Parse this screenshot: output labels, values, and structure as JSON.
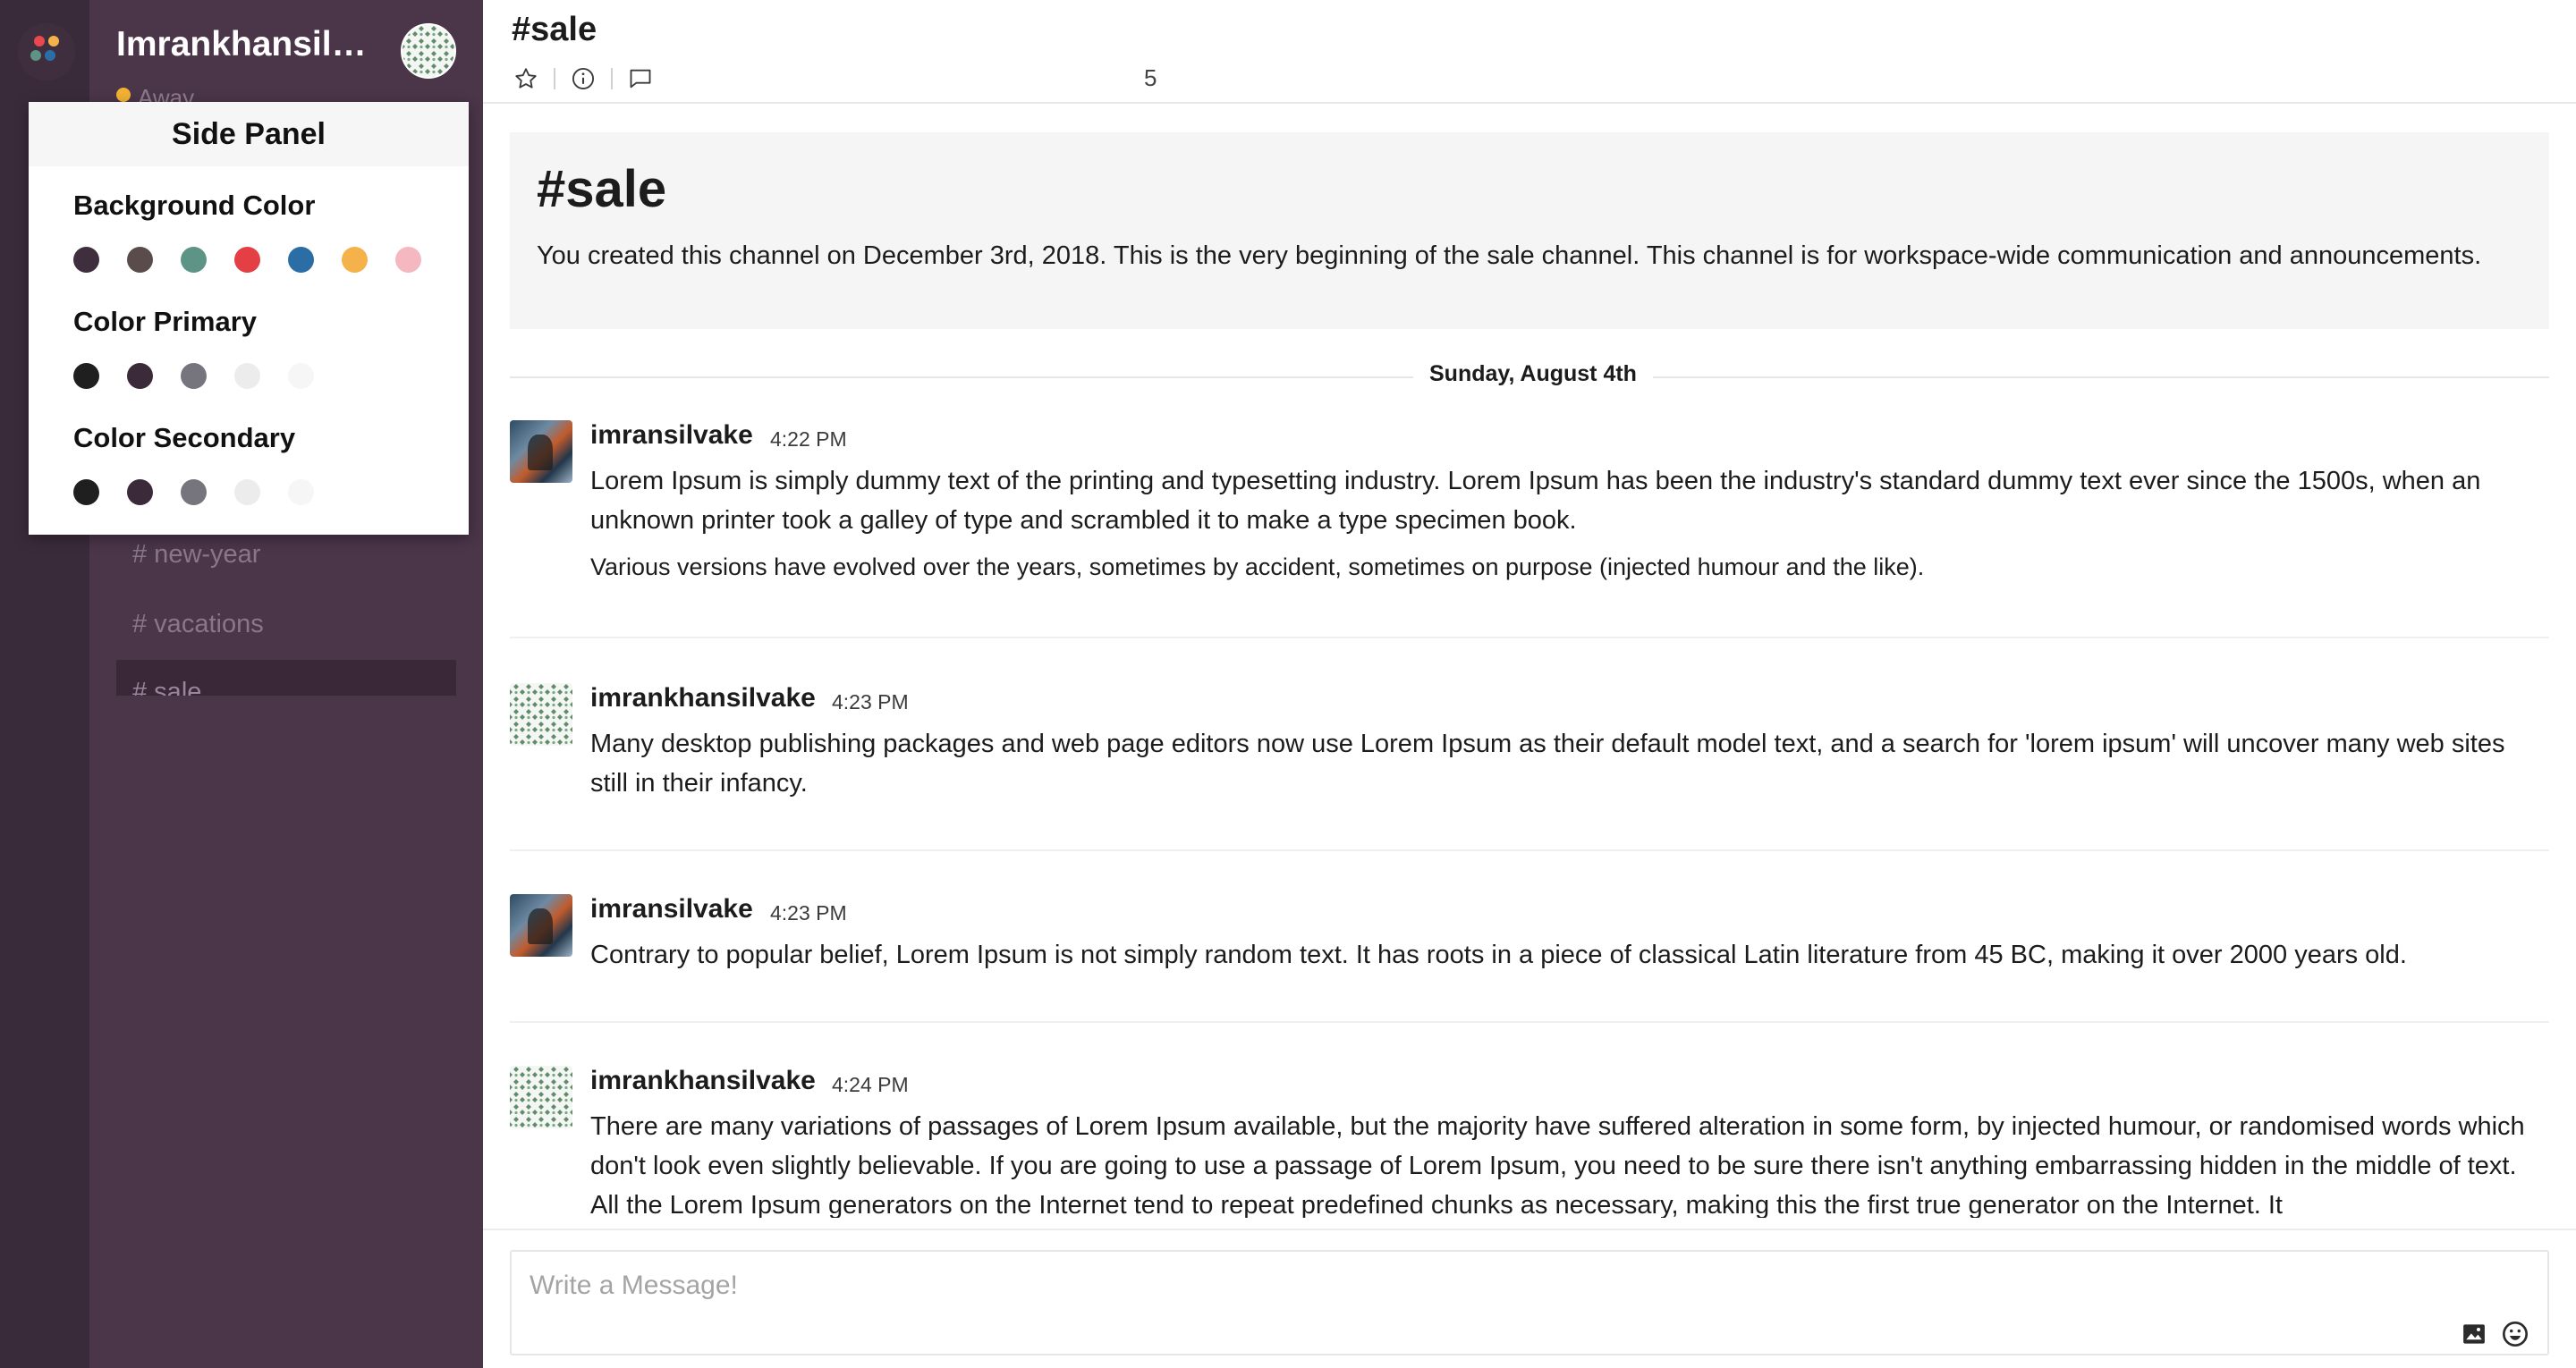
{
  "workspace": {
    "name": "Imrankhansilvake",
    "status": "Away",
    "logo_icon": "workspace-logo-icon"
  },
  "sidebar": {
    "channels": [
      {
        "label": "# new-year",
        "active": false
      },
      {
        "label": "# vacations",
        "active": false
      },
      {
        "label": "# sale",
        "active": true
      }
    ]
  },
  "side_panel": {
    "title": "Side Panel",
    "sections": [
      {
        "heading": "Background Color",
        "swatches": [
          "#3f2f3e",
          "#5a4c4a",
          "#5e9486",
          "#e33f45",
          "#2b6ea6",
          "#f5b24a",
          "#f5b7c0"
        ]
      },
      {
        "heading": "Color Primary",
        "swatches": [
          "#1f1f1f",
          "#3b2a39",
          "#76747c",
          "#ececec",
          "#f6f6f6"
        ]
      },
      {
        "heading": "Color Secondary",
        "swatches": [
          "#1f1f1f",
          "#3b2a39",
          "#76747c",
          "#ececec",
          "#f6f6f6"
        ]
      }
    ]
  },
  "header": {
    "title": "#sale",
    "thread_count": "5",
    "icons": [
      "star-icon",
      "info-icon",
      "thread-icon"
    ]
  },
  "intro": {
    "title": "#sale",
    "text": "You created this channel on December 3rd, 2018. This is the very beginning of the sale channel. This channel is for workspace-wide communication and announcements."
  },
  "day_divider": "Sunday, August 4th",
  "messages": [
    {
      "author": "imransilvake",
      "time": "4:22 PM",
      "avatar": "photo",
      "text": "Lorem Ipsum is simply dummy text of the printing and typesetting industry. Lorem Ipsum has been the industry's standard dummy text ever since the 1500s, when an unknown printer took a galley of type and scrambled it to make a type specimen book.",
      "text2": "Various versions have evolved over the years, sometimes by accident, sometimes on purpose (injected humour and the like)."
    },
    {
      "author": "imrankhansilvake",
      "time": "4:23 PM",
      "avatar": "pattern",
      "text": "Many desktop publishing packages and web page editors now use Lorem Ipsum as their default model text, and a search for 'lorem ipsum' will uncover many web sites still in their infancy."
    },
    {
      "author": "imransilvake",
      "time": "4:23 PM",
      "avatar": "photo",
      "text": "Contrary to popular belief, Lorem Ipsum is not simply random text. It has roots in a piece of classical Latin literature from 45 BC, making it over 2000 years old."
    },
    {
      "author": "imrankhansilvake",
      "time": "4:24 PM",
      "avatar": "pattern",
      "text": "There are many variations of passages of Lorem Ipsum available, but the majority have suffered alteration in some form, by injected humour, or randomised words which don't look even slightly believable. If you are going to use a passage of Lorem Ipsum, you need to be sure there isn't anything embarrassing hidden in the middle of text. All the Lorem Ipsum generators on the Internet tend to repeat predefined chunks as necessary, making this the first true generator on the Internet. It"
    }
  ],
  "composer": {
    "placeholder": "Write a Message!",
    "icons": [
      "image-icon",
      "emoji-icon"
    ]
  },
  "colors": {
    "sidebar": "#4a3549",
    "rail": "#3a2b3a",
    "status_away": "#f2b134"
  }
}
